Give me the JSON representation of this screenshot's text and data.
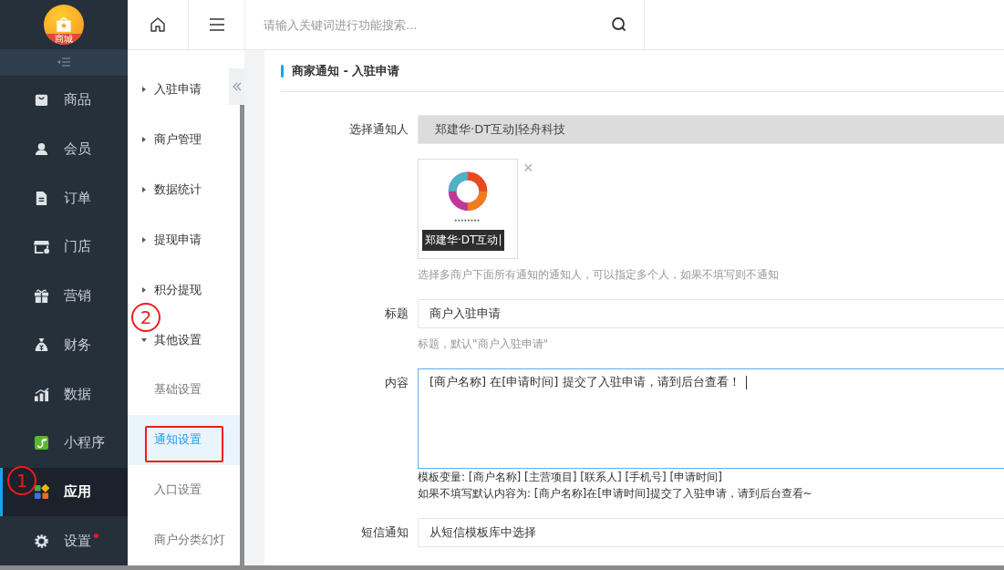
{
  "logo": {
    "text": "商城"
  },
  "sidebar": {
    "items": [
      {
        "label": "商品",
        "selected": false,
        "badge": false
      },
      {
        "label": "会员",
        "selected": false,
        "badge": false
      },
      {
        "label": "订单",
        "selected": false,
        "badge": false
      },
      {
        "label": "门店",
        "selected": false,
        "badge": false
      },
      {
        "label": "营销",
        "selected": false,
        "badge": false
      },
      {
        "label": "财务",
        "selected": false,
        "badge": false
      },
      {
        "label": "数据",
        "selected": false,
        "badge": false
      },
      {
        "label": "小程序",
        "selected": false,
        "badge": false
      },
      {
        "label": "应用",
        "selected": true,
        "badge": false
      },
      {
        "label": "设置",
        "selected": false,
        "badge": true
      }
    ]
  },
  "topbar": {
    "search": {
      "placeholder": "请输入关键词进行功能搜索..."
    }
  },
  "submenu": {
    "items": [
      {
        "label": "入驻申请",
        "kind": "group",
        "expanded": false
      },
      {
        "label": "商户管理",
        "kind": "group",
        "expanded": false
      },
      {
        "label": "数据统计",
        "kind": "group",
        "expanded": false
      },
      {
        "label": "提现申请",
        "kind": "group",
        "expanded": false
      },
      {
        "label": "积分提现",
        "kind": "group",
        "expanded": false
      },
      {
        "label": "其他设置",
        "kind": "group",
        "expanded": true,
        "children": [
          {
            "label": "基础设置",
            "selected": false
          },
          {
            "label": "通知设置",
            "selected": true
          },
          {
            "label": "入口设置",
            "selected": false
          },
          {
            "label": "商户分类幻灯",
            "selected": false
          }
        ]
      }
    ]
  },
  "content": {
    "title": "商家通知 - 入驻申请",
    "fields": [
      {
        "label": "选择通知人",
        "kind": "select",
        "value": "郑建华·DT互动|轻舟科技",
        "chosen": {
          "caption": "郑建华·DT互动|",
          "remove": "×"
        },
        "help": [
          "选择多商户下面所有通知的通知人，可以指定多个人，如果不填写则不通知"
        ]
      },
      {
        "label": "标题",
        "kind": "input",
        "value": "商户入驻申请",
        "help": [
          "标题，默认\"商户入驻申请\""
        ]
      },
      {
        "label": "内容",
        "kind": "textarea",
        "value": "[商户名称] 在[申请时间] 提交了入驻申请，请到后台查看！",
        "focused": true,
        "help": [
          "模板变量: [商户名称] [主营项目] [联系人] [手机号] [申请时间]",
          "如果不填写默认内容为: [商户名称]在[申请时间]提交了入驻申请，请到后台查看~"
        ]
      },
      {
        "label": "短信通知",
        "kind": "input",
        "value": "从短信模板库中选择"
      }
    ]
  },
  "annotations": [
    {
      "kind": "marker",
      "text": "1"
    },
    {
      "kind": "marker",
      "text": "2"
    },
    {
      "kind": "highlight"
    }
  ]
}
